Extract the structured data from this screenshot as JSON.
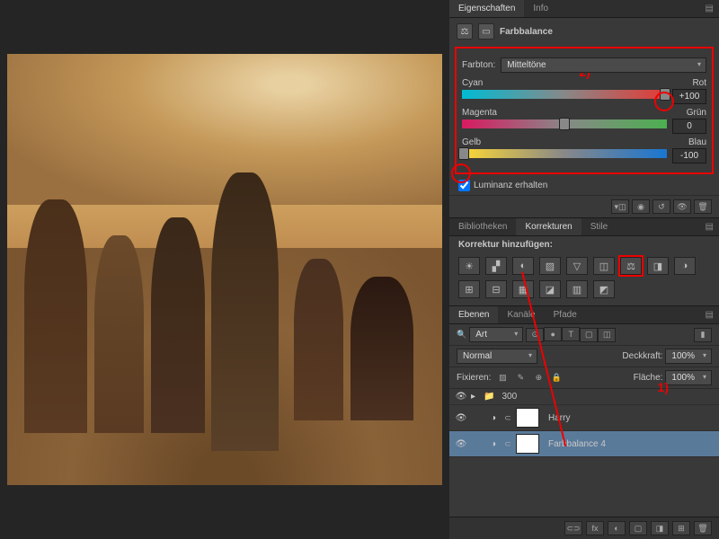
{
  "tabs_top": {
    "props": "Eigenschaften",
    "info": "Info"
  },
  "prop_title": "Farbbalance",
  "tone_label": "Farbton:",
  "tone_value": "Mitteltöne",
  "sliders": {
    "cr": {
      "left": "Cyan",
      "right": "Rot",
      "value": "+100",
      "pos": 100
    },
    "mg": {
      "left": "Magenta",
      "right": "Grün",
      "value": "0",
      "pos": 50
    },
    "yb": {
      "left": "Gelb",
      "right": "Blau",
      "value": "-100",
      "pos": 0
    }
  },
  "preserve_lum": "Luminanz erhalten",
  "annotations": {
    "a1": "1)",
    "a2": "2)"
  },
  "mid_tabs": {
    "lib": "Bibliotheken",
    "adj": "Korrekturen",
    "styles": "Stile"
  },
  "add_adj": "Korrektur hinzufügen:",
  "adj_icons": [
    "☀",
    "▞",
    "◐",
    "▨",
    "▽",
    "◫",
    "⚖",
    "◨",
    "◑",
    "⊞",
    "⊟",
    "▦",
    "◪",
    "▥",
    "◩"
  ],
  "layer_tabs": {
    "layers": "Ebenen",
    "channels": "Kanäle",
    "paths": "Pfade"
  },
  "filter_label": "Art",
  "filter_icons": [
    "⊙",
    "●",
    "T",
    "▢",
    "◫"
  ],
  "blend": {
    "mode": "Normal",
    "opacity_l": "Deckkraft:",
    "opacity_v": "100%",
    "lock_l": "Fixieren:",
    "fill_l": "Fläche:",
    "fill_v": "100%"
  },
  "lock_icons": [
    "▨",
    "✎",
    "⊕",
    "🔒"
  ],
  "layers": [
    {
      "name": "300",
      "type": "group",
      "open": false
    },
    {
      "name": "Harry",
      "type": "adj"
    },
    {
      "name": "Farbbalance 4",
      "type": "adj",
      "selected": true
    }
  ],
  "footer_icons": [
    "⊂⊃",
    "fx",
    "◐",
    "▢",
    "◨",
    "⊞",
    "🗑"
  ]
}
